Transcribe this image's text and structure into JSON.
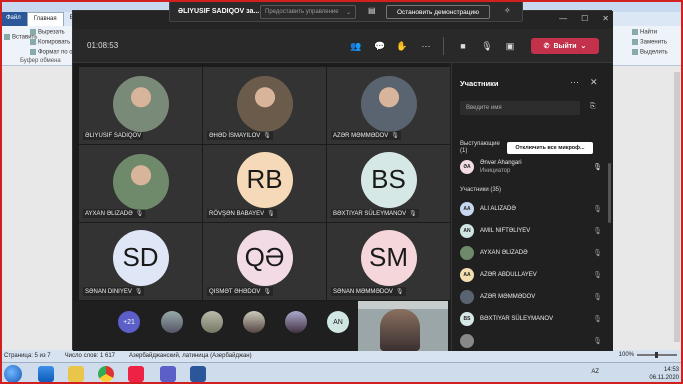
{
  "word": {
    "tabs": [
      "Файл",
      "Главная",
      "Вс"
    ],
    "clipboard": {
      "paste": "Вставить",
      "cut": "Вырезать",
      "copy": "Копировать",
      "format": "Формат по о",
      "group": "Буфер обмена"
    },
    "right_tools": {
      "find": "Найти",
      "replace": "Заменить",
      "select": "Выделить"
    },
    "status": {
      "page": "Страница: 5 из 7",
      "words": "Число слов: 1 617",
      "lang": "Азербайджанский, латиница (Азербайджан)",
      "zoom": "100%"
    }
  },
  "taskbar": {
    "lang": "AZ",
    "time": "14:53",
    "date": "06.11.2020"
  },
  "share_bar": {
    "title": "ƏLIYUSIF SADIQOV за...",
    "control_label": "Предоставить управление",
    "stop_label": "Остановить демонстрацию"
  },
  "call": {
    "timer": "01:08:53",
    "leave_label": "Выйти"
  },
  "tiles": [
    {
      "name": "ƏLIYUSIF SADIQOV",
      "type": "photo",
      "muted": false,
      "color": "#7a8a78"
    },
    {
      "name": "ƏHƏD İSMAYILOV",
      "type": "photo",
      "muted": true,
      "color": "#6b5b4a"
    },
    {
      "name": "AZƏR MƏMMƏDOV",
      "type": "photo",
      "muted": true,
      "color": "#5a6470"
    },
    {
      "name": "AYXAN ƏLIZADƏ",
      "type": "photo",
      "muted": true,
      "color": "#6e8a6a"
    },
    {
      "name": "RÖVŞƏN BABAYEV",
      "type": "initials",
      "initials": "RB",
      "muted": true,
      "color": "#f6d9b8"
    },
    {
      "name": "BƏXTIYAR SÜLEYMANOV",
      "type": "initials",
      "initials": "BS",
      "muted": true,
      "color": "#d6e8e6"
    },
    {
      "name": "SƏNAN DINIYEV",
      "type": "initials",
      "initials": "SD",
      "muted": true,
      "color": "#dfe6f5"
    },
    {
      "name": "QISMƏT ƏHƏDOV",
      "type": "initials",
      "initials": "QƏ",
      "muted": true,
      "color": "#f2dbe4"
    },
    {
      "name": "SƏNAN MƏMMƏDOV",
      "type": "initials",
      "initials": "SM",
      "muted": true,
      "color": "#f5d6da"
    }
  ],
  "bottom": {
    "overflow": "+21",
    "mini_initials": "AN"
  },
  "panel": {
    "title": "Участники",
    "search_placeholder": "Введите имя",
    "presenters_label": "Выступающие (1)",
    "mute_all": "Отключить все микроф...",
    "presenter": {
      "name": "Ənvər Ahangari",
      "role": "Инициатор",
      "initials": "ƏA"
    },
    "attendees_label": "Участники (35)",
    "attendees": [
      {
        "name": "ALI ALIZADƏ",
        "initials": "AA",
        "color": "#c8d6f0"
      },
      {
        "name": "AMIL NIFTƏLIYEV",
        "initials": "AN",
        "color": "#cfe6e2"
      },
      {
        "name": "AYXAN ƏLIZADƏ",
        "initials": "",
        "color": "#6e8a6a"
      },
      {
        "name": "AZƏR ABDULLAYEV",
        "initials": "AA",
        "color": "#f3dfb2"
      },
      {
        "name": "AZƏR MƏMMƏDOV",
        "initials": "",
        "color": "#5a6470"
      },
      {
        "name": "BƏXTIYAR SÜLEYMANOV",
        "initials": "BS",
        "color": "#d6e8e6"
      },
      {
        "name": "",
        "initials": "",
        "color": "#888"
      }
    ]
  }
}
